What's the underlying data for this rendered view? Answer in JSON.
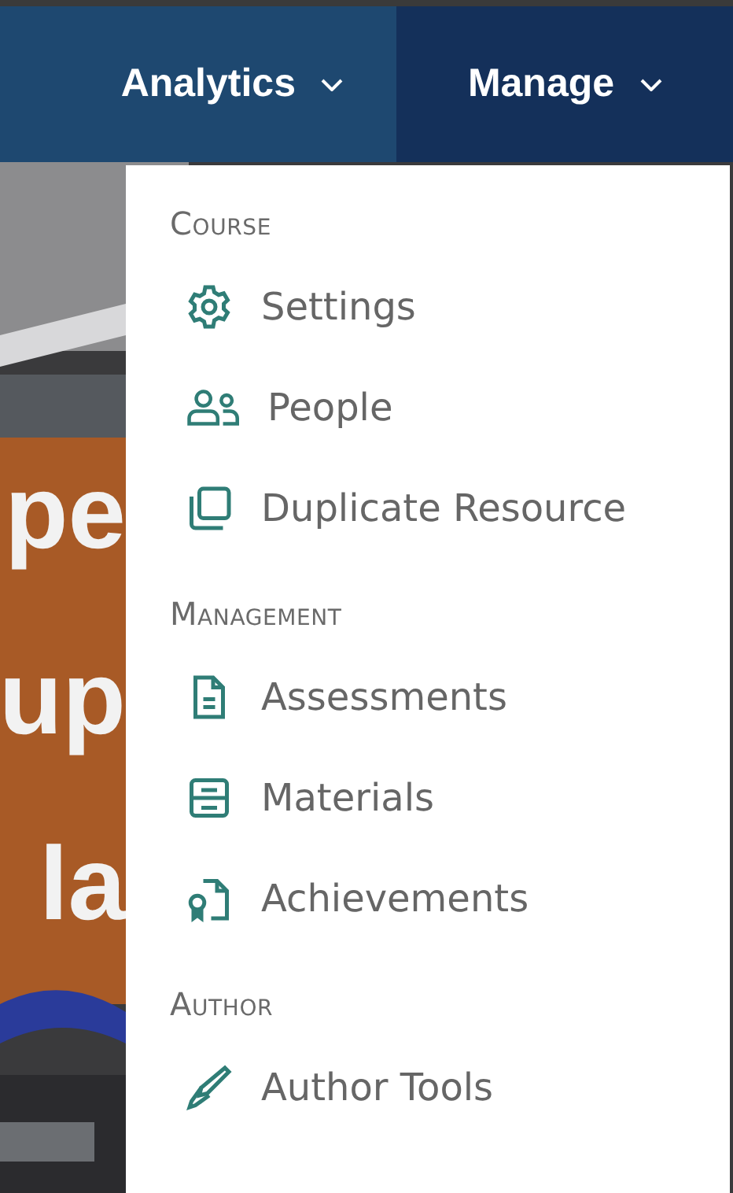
{
  "nav": [
    {
      "label": "Analytics",
      "kind": "dropdown",
      "expanded": false
    },
    {
      "label": "Manage",
      "kind": "dropdown",
      "expanded": true
    }
  ],
  "hero": {
    "kind": "picture",
    "lines": [
      "pe",
      "up",
      "la"
    ]
  },
  "menu": {
    "sections": [
      {
        "heading": "Course",
        "items": [
          {
            "label": "Settings",
            "kind": "gear"
          },
          {
            "label": "People",
            "kind": "people"
          },
          {
            "label": "Duplicate Resource",
            "kind": "copy"
          }
        ]
      },
      {
        "heading": "Management",
        "items": [
          {
            "label": "Assessments",
            "kind": "document"
          },
          {
            "label": "Materials",
            "kind": "cabinet"
          },
          {
            "label": "Achievements",
            "kind": "badge"
          }
        ]
      },
      {
        "heading": "Author",
        "items": [
          {
            "label": "Author Tools",
            "kind": "pen"
          }
        ]
      }
    ]
  }
}
